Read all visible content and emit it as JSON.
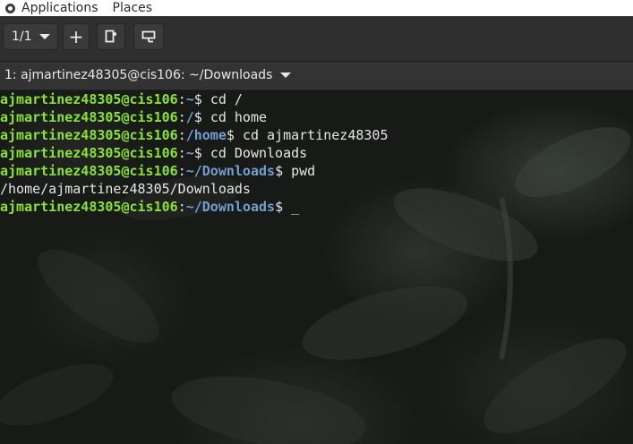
{
  "topbar": {
    "applications": "Applications",
    "places": "Places"
  },
  "toolbar": {
    "tab_counter": "1/1",
    "add_label": "+"
  },
  "tab": {
    "title": "1: ajmartinez48305@cis106: ~/Downloads"
  },
  "terminal": {
    "lines": [
      {
        "user": "ajmartinez48305@cis106",
        "sep": ":",
        "path": "~",
        "prompt": "$ ",
        "cmd": "cd /"
      },
      {
        "user": "ajmartinez48305@cis106",
        "sep": ":",
        "path": "/",
        "prompt": "$ ",
        "cmd": "cd home"
      },
      {
        "user": "ajmartinez48305@cis106",
        "sep": ":",
        "path": "/home",
        "prompt": "$ ",
        "cmd": "cd ajmartinez48305"
      },
      {
        "user": "ajmartinez48305@cis106",
        "sep": ":",
        "path": "~",
        "prompt": "$ ",
        "cmd": "cd Downloads"
      },
      {
        "user": "ajmartinez48305@cis106",
        "sep": ":",
        "path": "~/Downloads",
        "prompt": "$ ",
        "cmd": "pwd"
      },
      {
        "output": "/home/ajmartinez48305/Downloads"
      },
      {
        "user": "ajmartinez48305@cis106",
        "sep": ":",
        "path": "~/Downloads",
        "prompt": "$ ",
        "cmd": "",
        "cursor": "_"
      }
    ]
  },
  "colors": {
    "user": "#8ae234",
    "path": "#729fcf",
    "text": "#e6e6e6",
    "toolbar_bg": "#2f2f2f"
  },
  "icons": [
    "ubuntu-logo-icon",
    "chevron-down-icon",
    "plus-icon",
    "split-terminal-icon",
    "detach-window-icon"
  ]
}
